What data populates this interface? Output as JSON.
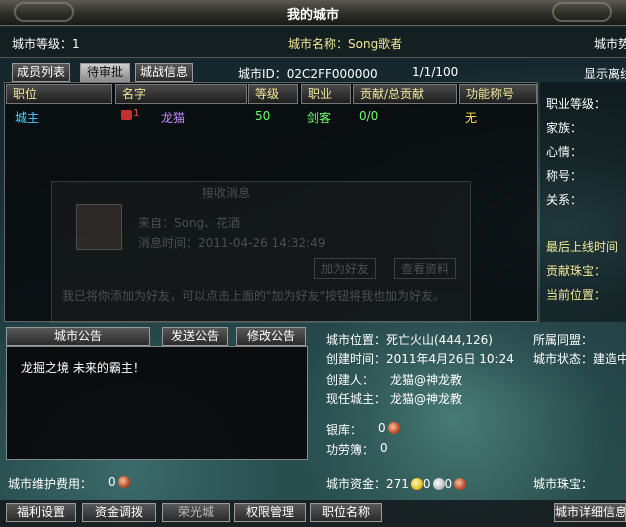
{
  "window": {
    "title": "我的城市"
  },
  "top": {
    "city_level": "城市等级：1",
    "city_name": "城市名称：Song歌者",
    "right_cut": "城市势"
  },
  "tabs": [
    {
      "label": "成员列表"
    },
    {
      "label": "待审批"
    },
    {
      "label": "城战信息"
    }
  ],
  "city_id": "城市ID：02C2FF000000",
  "member_count": "1/1/100",
  "show_toggle": "显示离线",
  "columns": [
    "职位",
    "名字",
    "等级",
    "职业",
    "贡献/总贡献",
    "功能称号"
  ],
  "rows": [
    {
      "position": "城主",
      "badge": "1",
      "name": "龙猫",
      "level": "50",
      "job": "剑客",
      "contrib": "0/0",
      "title": "无"
    }
  ],
  "ghost_dialog": {
    "title": "接收消息",
    "from": "来自：Song、花酒",
    "time": "消息时间：2011-04-26 14:32:49",
    "add_friend": "加为好友",
    "view_info": "查看资料",
    "body": "我已将你添加为好友，可以点击上面的\"加为好友\"按钮将我也加为好友。"
  },
  "side_info": {
    "job_level": "职业等级：",
    "family": "家族：",
    "mood": "心情：",
    "nickname": "称号：",
    "relation": "关系：",
    "last_online": "最后上线时间",
    "contrib_gem": "贡献珠宝：",
    "location": "当前位置："
  },
  "notice": {
    "label": "城市公告",
    "send": "发送公告",
    "edit": "修改公告",
    "text": "龙掘之境 未来的霸主！"
  },
  "city_info": {
    "position": "城市位置：死亡火山(444,126)",
    "alliance": "所属同盟：",
    "created": "创建时间：2011年4月26日 10:24",
    "status": "城市状态：建造中",
    "creator_label": "创建人：",
    "creator": "龙猫@神龙教",
    "lord_label": "现任城主：",
    "lord": "龙猫@神龙教",
    "bank_label": "银库：",
    "bank": "0",
    "merit_label": "功劳簿：",
    "merit": "0"
  },
  "footer": {
    "maintenance_label": "城市维护费用：",
    "maintenance": "0",
    "funds_label": "城市资金：271",
    "funds_silver": "0",
    "funds_copper": "0",
    "gem_label": "城市珠宝："
  },
  "bottom_buttons": [
    {
      "label": "福利设置"
    },
    {
      "label": "资金调拨"
    },
    {
      "label": "荣光城"
    },
    {
      "label": "权限管理"
    },
    {
      "label": "职位名称"
    },
    {
      "label": "城市详细信息"
    }
  ],
  "colors": {
    "gold_text": "#f2e89a",
    "cyan_text": "#4fd0ff",
    "green_text": "#6cff6c",
    "purple_name": "#c08cff",
    "yellow_text": "#ffe34a"
  }
}
